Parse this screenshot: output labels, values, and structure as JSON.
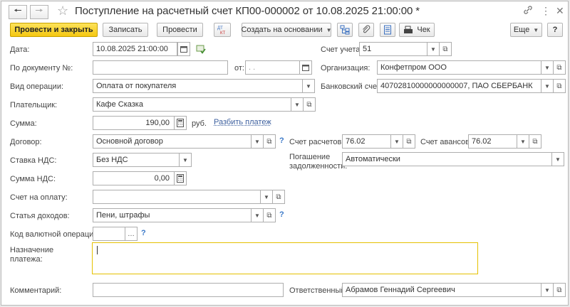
{
  "title": "Поступление на расчетный счет КП00-000002 от 10.08.2025 21:00:00 *",
  "toolbar": {
    "post_close": "Провести и закрыть",
    "save": "Записать",
    "post": "Провести",
    "dt_kt": "Дт Кт",
    "create_basis": "Создать на основании",
    "check": "Чек",
    "more": "Еще",
    "help": "?"
  },
  "form": {
    "date": {
      "label": "Дата:",
      "value": "10.08.2025 21:00:00"
    },
    "doc_number": {
      "label": "По документу №:",
      "value": ""
    },
    "from": {
      "label": "от:",
      "value": " .  .    "
    },
    "account": {
      "label": "Счет учета:",
      "value": "51"
    },
    "organization": {
      "label": "Организация:",
      "value": "Конфетпром ООО"
    },
    "operation": {
      "label": "Вид операции:",
      "value": "Оплата от покупателя"
    },
    "bank_account": {
      "label": "Банковский счет:",
      "value": "40702810000000000007, ПАО СБЕРБАНК"
    },
    "payer": {
      "label": "Плательщик:",
      "value": "Кафе Сказка"
    },
    "amount": {
      "label": "Сумма:",
      "value": "190,00",
      "unit": "руб.",
      "split_link": "Разбить платеж"
    },
    "contract": {
      "label": "Договор:",
      "value": "Основной договор"
    },
    "settlement_account": {
      "label": "Счет расчетов:",
      "value": "76.02"
    },
    "advance_account": {
      "label": "Счет авансов:",
      "value": "76.02"
    },
    "vat_rate": {
      "label": "Ставка НДС:",
      "value": "Без НДС"
    },
    "debt_repayment": {
      "label_line1": "Погашение",
      "label_line2": "задолженности:",
      "value": "Автоматически"
    },
    "vat_amount": {
      "label": "Сумма НДС:",
      "value": "0,00"
    },
    "invoice": {
      "label": "Счет на оплату:",
      "value": ""
    },
    "income_item": {
      "label": "Статья доходов:",
      "value": "Пени, штрафы"
    },
    "currency_op": {
      "label": "Код валютной операции:",
      "value": ""
    },
    "purpose": {
      "label_line1": "Назначение",
      "label_line2": "платежа:",
      "value": ""
    },
    "comment": {
      "label": "Комментарий:",
      "value": ""
    },
    "responsible": {
      "label": "Ответственный:",
      "value": "Абрамов Геннадий Сергеевич"
    }
  },
  "hint_symbol": "?",
  "colors": {
    "primary_button": "#f5c711",
    "link": "#3c5f9e",
    "focus_border": "#e5c100"
  }
}
